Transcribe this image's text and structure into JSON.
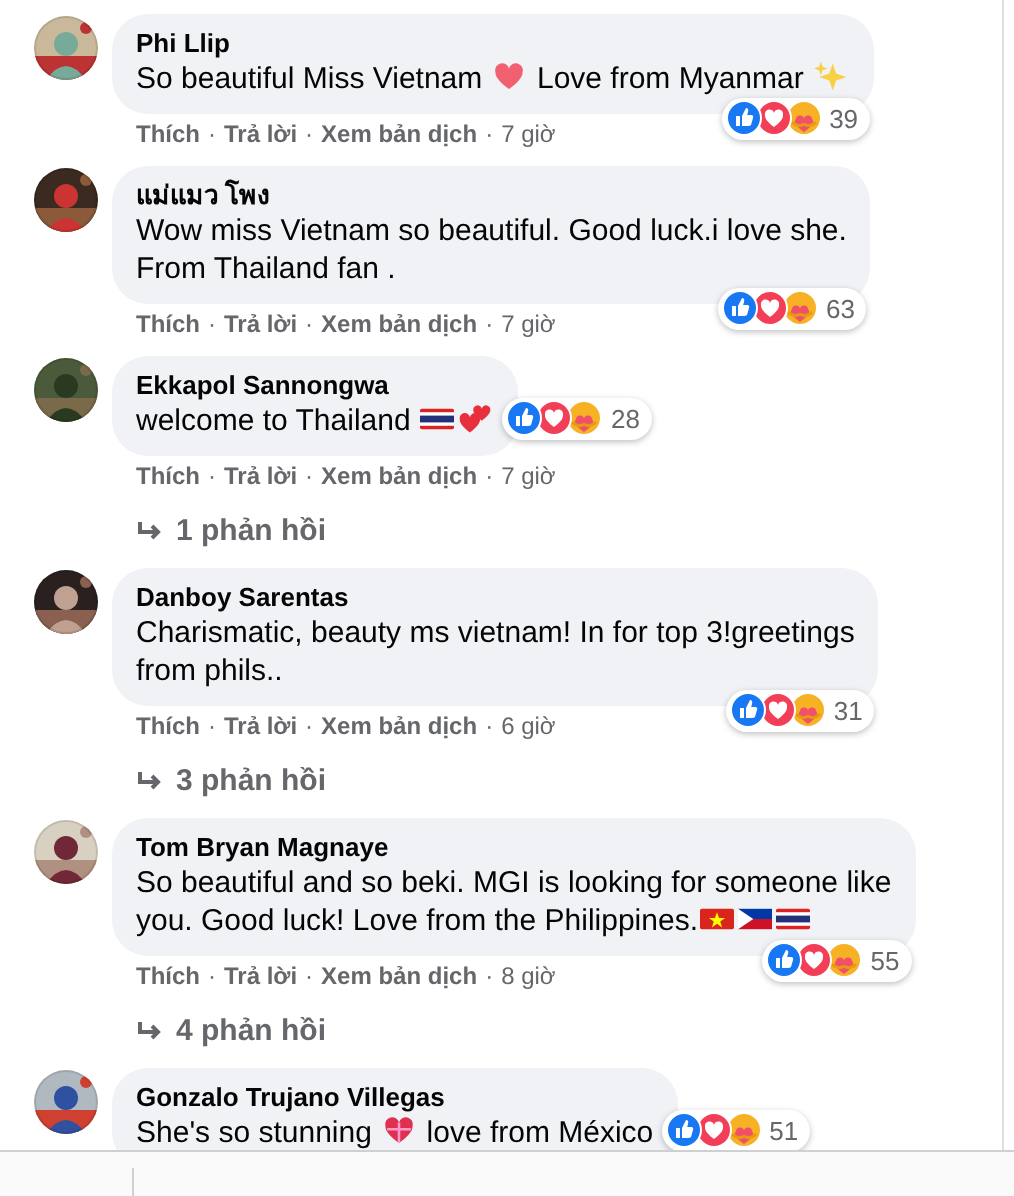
{
  "actions_separator": "·",
  "comments": [
    {
      "name": "Phi Llip",
      "body": [
        {
          "kind": "text",
          "text": "So beautiful Miss Vietnam "
        },
        {
          "kind": "heart"
        },
        {
          "kind": "text",
          "text": " Love from Myanmar "
        },
        {
          "kind": "sparkles"
        }
      ],
      "actions": [
        "Thích",
        "Trả lời",
        "Xem bản dịch"
      ],
      "time": "7 giờ",
      "reaction_count": "39",
      "reactions_beside": false
    },
    {
      "name": "แม่แมว โพง",
      "body": [
        {
          "kind": "text",
          "text": "Wow miss Vietnam so beautiful. Good luck.i love she.\nFrom Thailand fan ."
        }
      ],
      "actions": [
        "Thích",
        "Trả lời",
        "Xem bản dịch"
      ],
      "time": "7 giờ",
      "reaction_count": "63",
      "reactions_beside": false
    },
    {
      "name": "Ekkapol Sannongwa",
      "body": [
        {
          "kind": "text",
          "text": "welcome to Thailand "
        },
        {
          "kind": "thaiflag"
        },
        {
          "kind": "twohearts"
        }
      ],
      "actions": [
        "Thích",
        "Trả lời",
        "Xem bản dịch"
      ],
      "time": "7 giờ",
      "reaction_count": "28",
      "reactions_beside": true,
      "replies": "1 phản hồi"
    },
    {
      "name": "Danboy Sarentas",
      "body": [
        {
          "kind": "text",
          "text": "Charismatic, beauty ms vietnam! In for top 3!greetings\nfrom phils.."
        }
      ],
      "actions": [
        "Thích",
        "Trả lời",
        "Xem bản dịch"
      ],
      "time": "6 giờ",
      "reaction_count": "31",
      "reactions_beside": false,
      "replies": "3 phản hồi"
    },
    {
      "name": "Tom Bryan Magnaye",
      "body": [
        {
          "kind": "text",
          "text": "So beautiful and so beki. MGI is looking for someone like\n"
        },
        {
          "kind": "text",
          "text": "you. Good luck! Love from the Philippines."
        },
        {
          "kind": "vnflag"
        },
        {
          "kind": "phflag"
        },
        {
          "kind": "thaiflag"
        }
      ],
      "actions": [
        "Thích",
        "Trả lời",
        "Xem bản dịch"
      ],
      "time": "8 giờ",
      "reaction_count": "55",
      "reactions_beside": false,
      "replies": "4 phản hồi"
    },
    {
      "name": "Gonzalo Trujano Villegas",
      "body": [
        {
          "kind": "text",
          "text": "She's so stunning "
        },
        {
          "kind": "giftheart"
        },
        {
          "kind": "text",
          "text": " love from México"
        }
      ],
      "reaction_count": "51",
      "reactions_beside": true
    }
  ]
}
